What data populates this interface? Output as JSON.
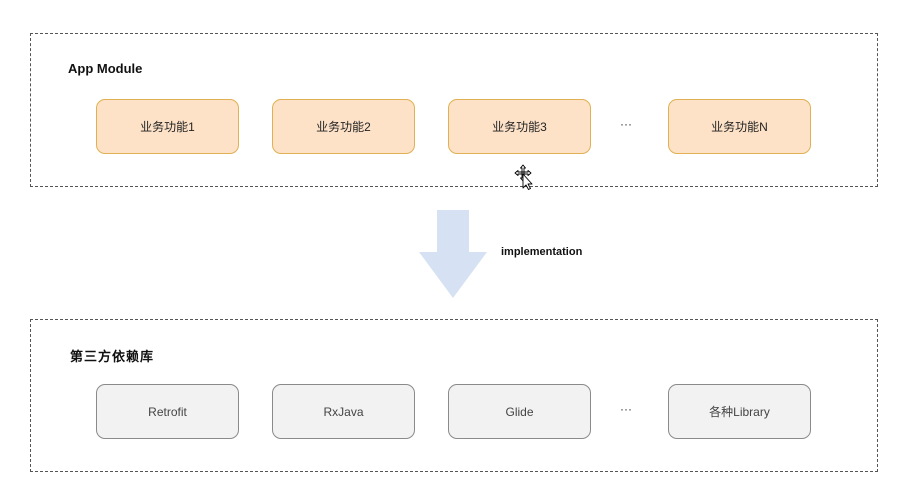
{
  "app_module": {
    "title": "App Module",
    "items": [
      "业务功能1",
      "业务功能2",
      "业务功能3",
      "业务功能N"
    ],
    "ellipsis": "···"
  },
  "dependency": {
    "label": "implementation"
  },
  "third_party": {
    "title": "第三方依赖库",
    "items": [
      "Retrofit",
      "RxJava",
      "Glide",
      "各种Library"
    ],
    "ellipsis": "···"
  },
  "colors": {
    "feature_fill": "#fde2c8",
    "feature_border": "#e0b052",
    "library_fill": "#f2f2f2",
    "library_border": "#8a8a8a",
    "arrow_fill": "#d6e2f4",
    "panel_border": "#555555"
  },
  "icons": {
    "arrow": "down-arrow-icon",
    "cursor": "move-cursor-icon"
  }
}
